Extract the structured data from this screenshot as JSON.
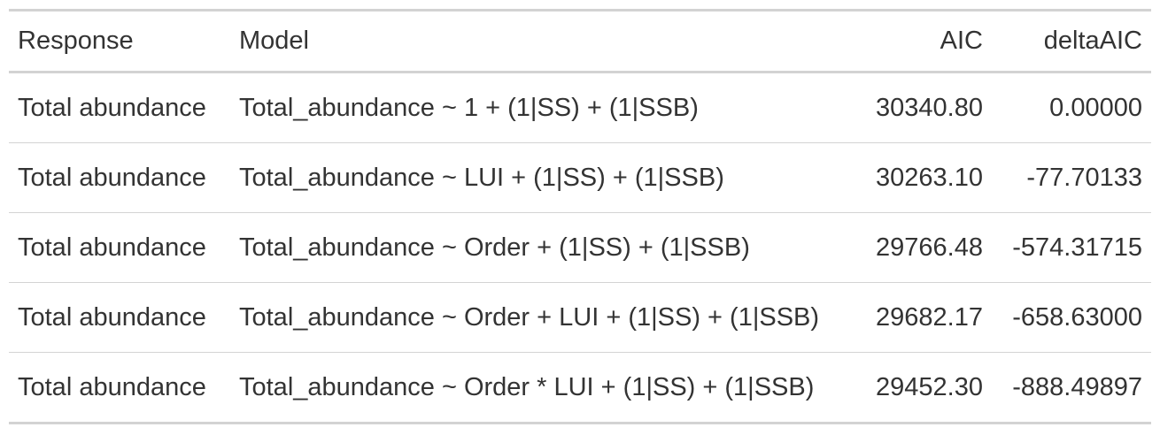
{
  "table": {
    "headers": {
      "response": "Response",
      "model": "Model",
      "aic": "AIC",
      "delta": "deltaAIC"
    },
    "rows": [
      {
        "response": "Total abundance",
        "model": "Total_abundance ~ 1 + (1|SS) + (1|SSB)",
        "aic": "30340.80",
        "delta": "0.00000"
      },
      {
        "response": "Total abundance",
        "model": "Total_abundance ~ LUI + (1|SS) + (1|SSB)",
        "aic": "30263.10",
        "delta": "-77.70133"
      },
      {
        "response": "Total abundance",
        "model": "Total_abundance ~ Order + (1|SS) + (1|SSB)",
        "aic": "29766.48",
        "delta": "-574.31715"
      },
      {
        "response": "Total abundance",
        "model": "Total_abundance ~ Order + LUI + (1|SS) + (1|SSB)",
        "aic": "29682.17",
        "delta": "-658.63000"
      },
      {
        "response": "Total abundance",
        "model": "Total_abundance ~ Order * LUI + (1|SS) + (1|SSB)",
        "aic": "29452.30",
        "delta": "-888.49897"
      }
    ]
  }
}
